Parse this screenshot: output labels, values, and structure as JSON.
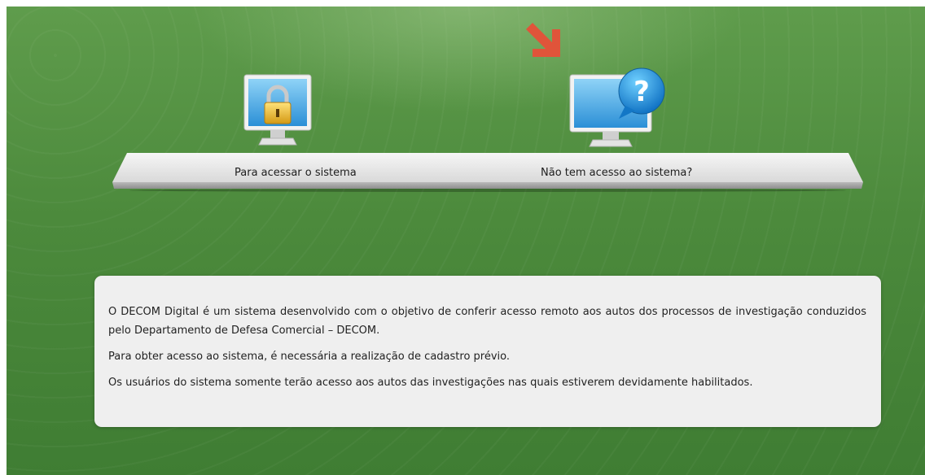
{
  "options": {
    "access": {
      "label": "Para acessar o sistema",
      "icon": "monitor-lock-icon"
    },
    "no_access": {
      "label": "Não tem acesso ao sistema?",
      "icon": "monitor-question-icon"
    },
    "pointer_icon": "red-arrow-icon"
  },
  "info": {
    "paragraphs": [
      "O DECOM Digital é um sistema desenvolvido com o objetivo de conferir acesso remoto aos autos dos processos de investigação conduzidos pelo Departamento de Defesa Comercial – DECOM.",
      "Para obter acesso ao sistema, é necessária a realização de cadastro prévio.",
      "Os usuários do sistema somente terão acesso aos autos das investigações nas quais estiverem devidamente habilitados."
    ]
  },
  "colors": {
    "background": "#4f8c3e",
    "arrow": "#e0543a",
    "info_box": "#efefef"
  }
}
